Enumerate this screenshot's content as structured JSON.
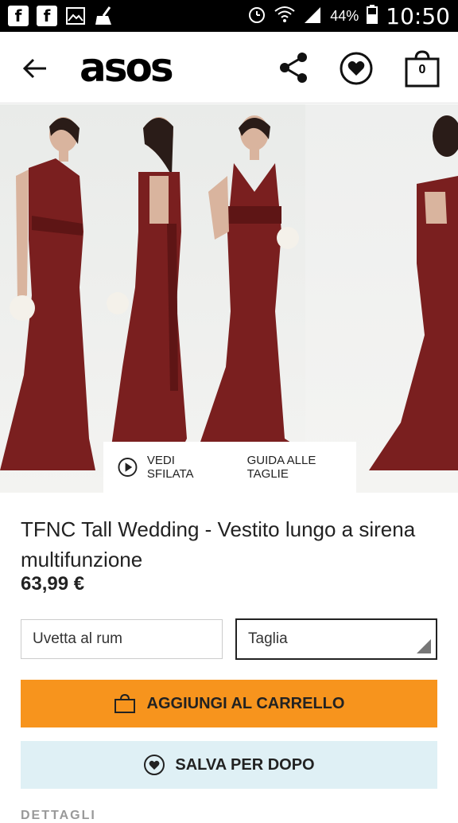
{
  "status_bar": {
    "notif_icons": [
      "facebook-icon",
      "facebook-icon",
      "gallery-icon",
      "broom-icon"
    ],
    "battery_percent": "44%",
    "time": "10:50"
  },
  "header": {
    "logo": "asos",
    "bag_count": "0"
  },
  "gallery": {
    "video_label": "VEDI SFILATA",
    "size_guide_label": "GUIDA ALLE TAGLIE"
  },
  "product": {
    "title": "TFNC Tall Wedding - Vestito lungo a sirena multifunzione",
    "price": "63,99 €"
  },
  "options": {
    "color_value": "Uvetta al rum",
    "size_placeholder": "Taglia"
  },
  "actions": {
    "add_to_cart": "AGGIUNGI AL CARRELLO",
    "save_for_later": "SALVA PER DOPO"
  },
  "details_heading": "DETTAGLI",
  "colors": {
    "accent_orange": "#f7941d",
    "save_bg": "#dff0f5",
    "dress": "#7a1f1f"
  }
}
